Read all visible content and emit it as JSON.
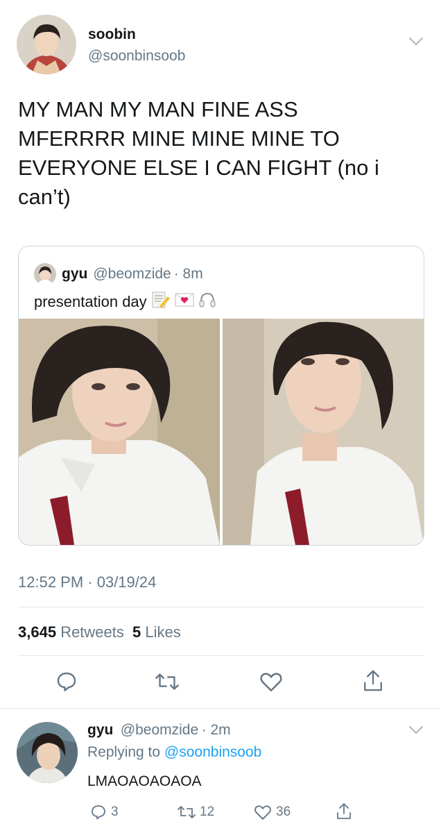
{
  "main_tweet": {
    "author_name": "soobin",
    "author_handle": "@soonbinsoob",
    "text": "MY MAN MY MAN FINE ASS MFERRRR MINE MINE MINE TO EVERYONE ELSE I CAN FIGHT (no i can’t)",
    "timestamp": "12:52 PM · 03/19/24",
    "retweets_count": "3,645",
    "retweets_label": "Retweets",
    "likes_count": "5",
    "likes_label": "Likes"
  },
  "quoted_tweet": {
    "author_name": "gyu",
    "author_handle": "@beomzide",
    "time": "· 8m",
    "text": "presentation day",
    "emojis": [
      "memo-icon",
      "love-letter-icon",
      "headphones-icon"
    ]
  },
  "reply": {
    "author_name": "gyu",
    "author_handle": "@beomzide",
    "time": "· 2m",
    "replying_prefix": "Replying to",
    "replying_handle": "@soonbinsoob",
    "text": "LMAOAOAOAOA",
    "reply_count": "3",
    "retweet_count": "12",
    "like_count": "36"
  },
  "colors": {
    "link": "#1da1f2",
    "secondary_text": "#657786",
    "divider": "#e1e8ed",
    "primary_text": "#14171a"
  }
}
